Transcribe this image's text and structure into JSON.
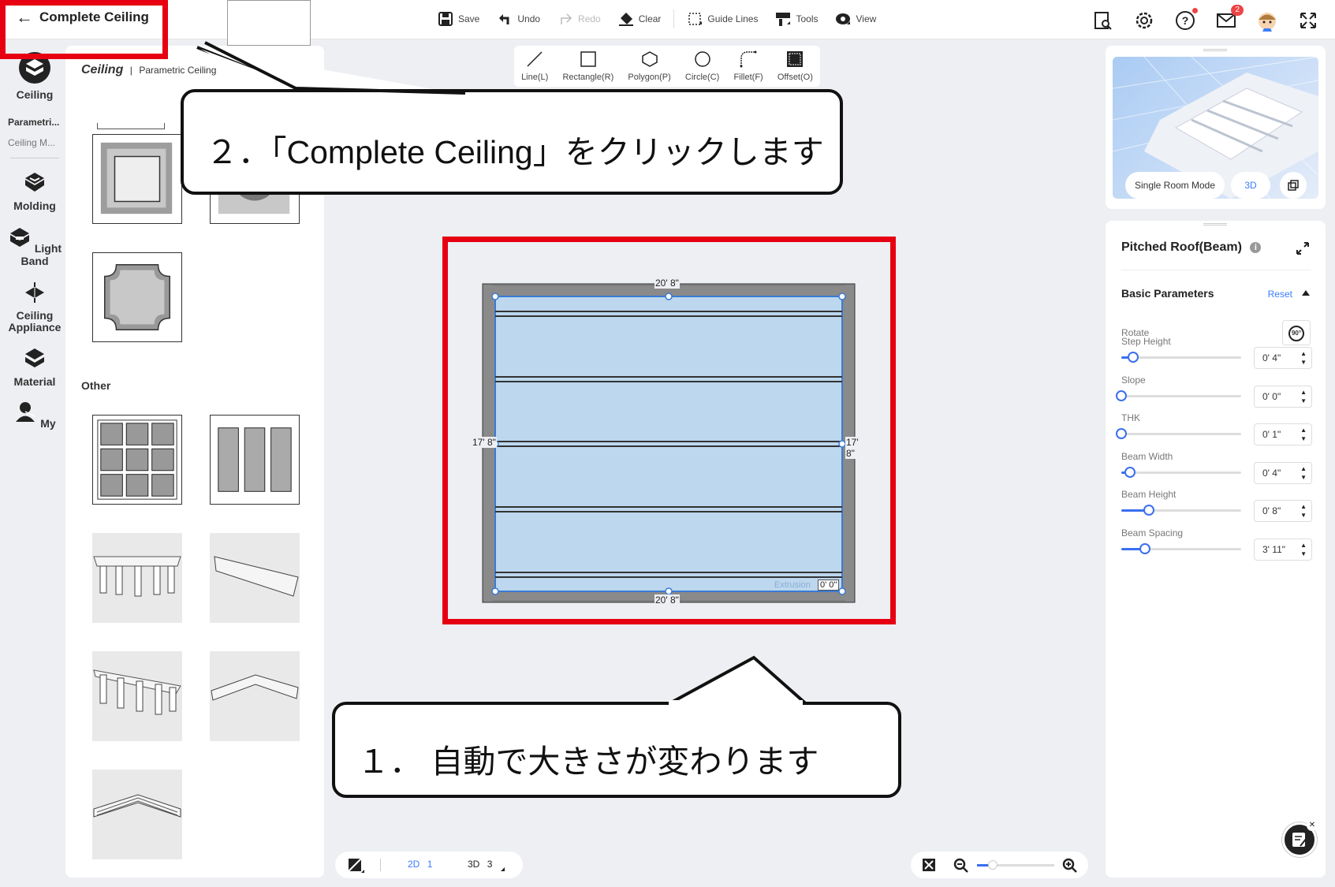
{
  "header": {
    "back_label": "Complete Ceiling",
    "toolbar": [
      {
        "label": "Save",
        "icon": "save-icon",
        "disabled": false
      },
      {
        "label": "Undo",
        "icon": "undo-icon",
        "disabled": false
      },
      {
        "label": "Redo",
        "icon": "redo-icon",
        "disabled": true
      },
      {
        "label": "Clear",
        "icon": "eraser-icon",
        "disabled": false
      },
      {
        "label": "Guide Lines",
        "icon": "guide-lines-icon",
        "disabled": false
      },
      {
        "label": "Tools",
        "icon": "tools-icon",
        "disabled": false
      },
      {
        "label": "View",
        "icon": "eye-icon",
        "disabled": false
      }
    ],
    "mail_badge": "2"
  },
  "leftnav": {
    "items": [
      {
        "label": "Ceiling",
        "icon": "ceiling-icon"
      },
      {
        "label": "Molding",
        "icon": "molding-icon"
      },
      {
        "label": "Light Band",
        "icon": "light-band-icon"
      },
      {
        "label": "Ceiling Appliance",
        "icon": "ceiling-appliance-icon"
      },
      {
        "label": "Material",
        "icon": "material-icon"
      },
      {
        "label": "My",
        "icon": "my-icon"
      }
    ],
    "sub_items": [
      "Parametri...",
      "Ceiling M..."
    ]
  },
  "panel": {
    "title": "Ceiling",
    "subtitle": "Parametric Ceiling",
    "other_label": "Other"
  },
  "draw_tools": [
    {
      "label": "Line(L)",
      "icon": "line-icon"
    },
    {
      "label": "Rectangle(R)",
      "icon": "rectangle-icon"
    },
    {
      "label": "Polygon(P)",
      "icon": "polygon-icon"
    },
    {
      "label": "Circle(C)",
      "icon": "circle-icon"
    },
    {
      "label": "Fillet(F)",
      "icon": "fillet-icon"
    },
    {
      "label": "Offset(O)",
      "icon": "offset-icon"
    }
  ],
  "plan": {
    "top_dim": "20' 8\"",
    "bottom_dim": "20' 8\"",
    "left_dim": "17' 8\"",
    "right_dim": "17' 8\"",
    "extrusion_label": "Extrusion",
    "extrusion_value": "0' 0\""
  },
  "callouts": {
    "step2": "２．「Complete Ceiling」をクリックします",
    "step1": "１． 自動で大きさが変わります"
  },
  "preview": {
    "single_room_label": "Single Room Mode",
    "mode_3d_label": "3D"
  },
  "props": {
    "title": "Pitched Roof(Beam)",
    "section": "Basic Parameters",
    "reset_label": "Reset",
    "rotate_label": "Rotate",
    "rotate_button": "90°",
    "params": [
      {
        "label": "Step Height",
        "value": "0' 4\"",
        "level": 0.1
      },
      {
        "label": "Slope",
        "value": "0' 0\"",
        "level": 0.0
      },
      {
        "label": "THK",
        "value": "0' 1\"",
        "level": 0.0
      },
      {
        "label": "Beam Width",
        "value": "0' 4\"",
        "level": 0.07
      },
      {
        "label": "Beam Height",
        "value": "0' 8\"",
        "level": 0.23
      },
      {
        "label": "Beam Spacing",
        "value": "3' 11\"",
        "level": 0.2
      }
    ]
  },
  "bottom": {
    "view_2d": "2D",
    "view_2d_count": "1",
    "view_3d": "3D",
    "view_3d_count": "3",
    "zoom_level": 0.1
  },
  "colors": {
    "accent": "#3a6ff0",
    "highlight_red": "#e60012",
    "plan_fill": "#bcd7ee",
    "badge_red": "#ee4444"
  }
}
